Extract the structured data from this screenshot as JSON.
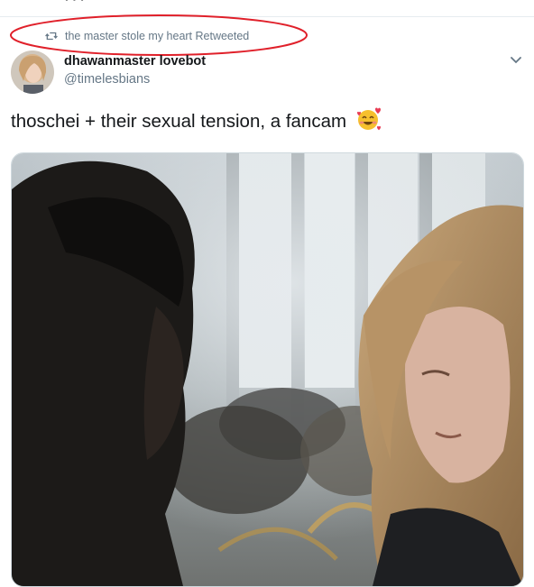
{
  "retweet": {
    "text": "the master stole my heart Retweeted",
    "icon": "retweet-icon"
  },
  "tweet": {
    "author_name": "dhawanmaster lovebot",
    "author_handle": "@timelesbians",
    "text": "thoschei + their sexual tension, a fancam",
    "emoji": "smiling-face-with-hearts-emoji",
    "menu_icon": "chevron-down-icon"
  },
  "colors": {
    "accent_highlight": "#e0202a",
    "secondary_text": "#657786",
    "primary_text": "#14171a"
  }
}
